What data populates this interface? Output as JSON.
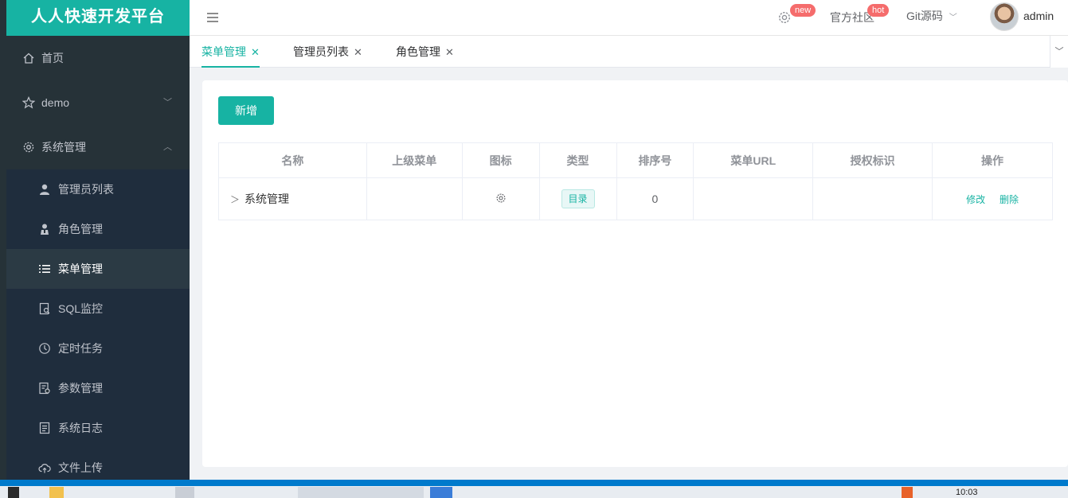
{
  "brand": {
    "title": "人人快速开发平台"
  },
  "sidebar": {
    "items": [
      {
        "label": "首页",
        "icon": "home-icon"
      },
      {
        "label": "demo",
        "icon": "star-icon"
      },
      {
        "label": "系统管理",
        "icon": "gear-icon"
      }
    ],
    "sub_items": [
      {
        "label": "管理员列表",
        "icon": "user-icon"
      },
      {
        "label": "角色管理",
        "icon": "role-icon"
      },
      {
        "label": "菜单管理",
        "icon": "list-icon"
      },
      {
        "label": "SQL监控",
        "icon": "sql-monitor-icon"
      },
      {
        "label": "定时任务",
        "icon": "clock-icon"
      },
      {
        "label": "参数管理",
        "icon": "config-icon"
      },
      {
        "label": "系统日志",
        "icon": "log-icon"
      },
      {
        "label": "文件上传",
        "icon": "cloud-upload-icon"
      }
    ],
    "active_sub": "菜单管理"
  },
  "navbar": {
    "settings_badge": "new",
    "community_label": "官方社区",
    "community_badge": "hot",
    "git_label": "Git源码",
    "username": "admin"
  },
  "tabs": [
    {
      "label": "菜单管理",
      "active": true
    },
    {
      "label": "管理员列表",
      "active": false
    },
    {
      "label": "角色管理",
      "active": false
    }
  ],
  "toolbar": {
    "add_label": "新增"
  },
  "table": {
    "columns": [
      "名称",
      "上级菜单",
      "图标",
      "类型",
      "排序号",
      "菜单URL",
      "授权标识",
      "操作"
    ],
    "rows": [
      {
        "name": "系统管理",
        "parent": "",
        "icon": "gear-icon",
        "type": "目录",
        "order": "0",
        "url": "",
        "perms": "",
        "edit": "修改",
        "delete": "删除"
      }
    ]
  },
  "taskbar": {
    "time": "10:03"
  },
  "colors": {
    "accent": "#17b3a3",
    "sidebar_bg": "#263238",
    "badge": "#f56c6c"
  }
}
